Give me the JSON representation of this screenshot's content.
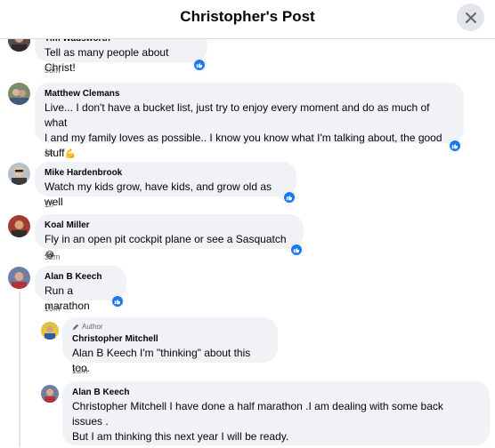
{
  "header": {
    "title": "Christopher's Post"
  },
  "comments": [
    {
      "name": "Tim Wadsworth",
      "text": "Tell as many people about Christ!",
      "time": "55m"
    },
    {
      "name": "Matthew Clemans",
      "text_line1": "Live... I don't have a bucket list, just try to enjoy every moment and do as much of what",
      "text_line2": "I and my family loves as possible.. I know you know what I'm talking about, the good",
      "text_line3": "stuff",
      "emoji": "💪",
      "time": "1h"
    },
    {
      "name": "Mike Hardenbrook",
      "text": "Watch my kids grow, have kids, and grow old as well",
      "time": "1h"
    },
    {
      "name": "Koal Miller",
      "text": "Fly in an open pit cockpit plane or see a Sasquatch",
      "emoji": "😂",
      "time": "32m"
    },
    {
      "name": "Alan B Keech",
      "text": "Run a marathon",
      "time": "15m"
    }
  ],
  "replies": [
    {
      "badge": "Author",
      "name": "Christopher Mitchell",
      "text": "Alan B Keech I'm \"thinking\" about this too.",
      "time": "13m"
    },
    {
      "name": "Alan B Keech",
      "text_line1": "Christopher Mitchell I have done a half marathon .I am dealing with some back",
      "text_line2": "issues .",
      "text_line3": "But I am thinking this next year I will be ready."
    }
  ],
  "colors": {
    "like_blue": "#1877f2",
    "bubble_bg": "#f0f2f5"
  },
  "icons": {
    "close": "close-icon",
    "like": "thumbs-up-icon",
    "author": "pencil-icon"
  }
}
